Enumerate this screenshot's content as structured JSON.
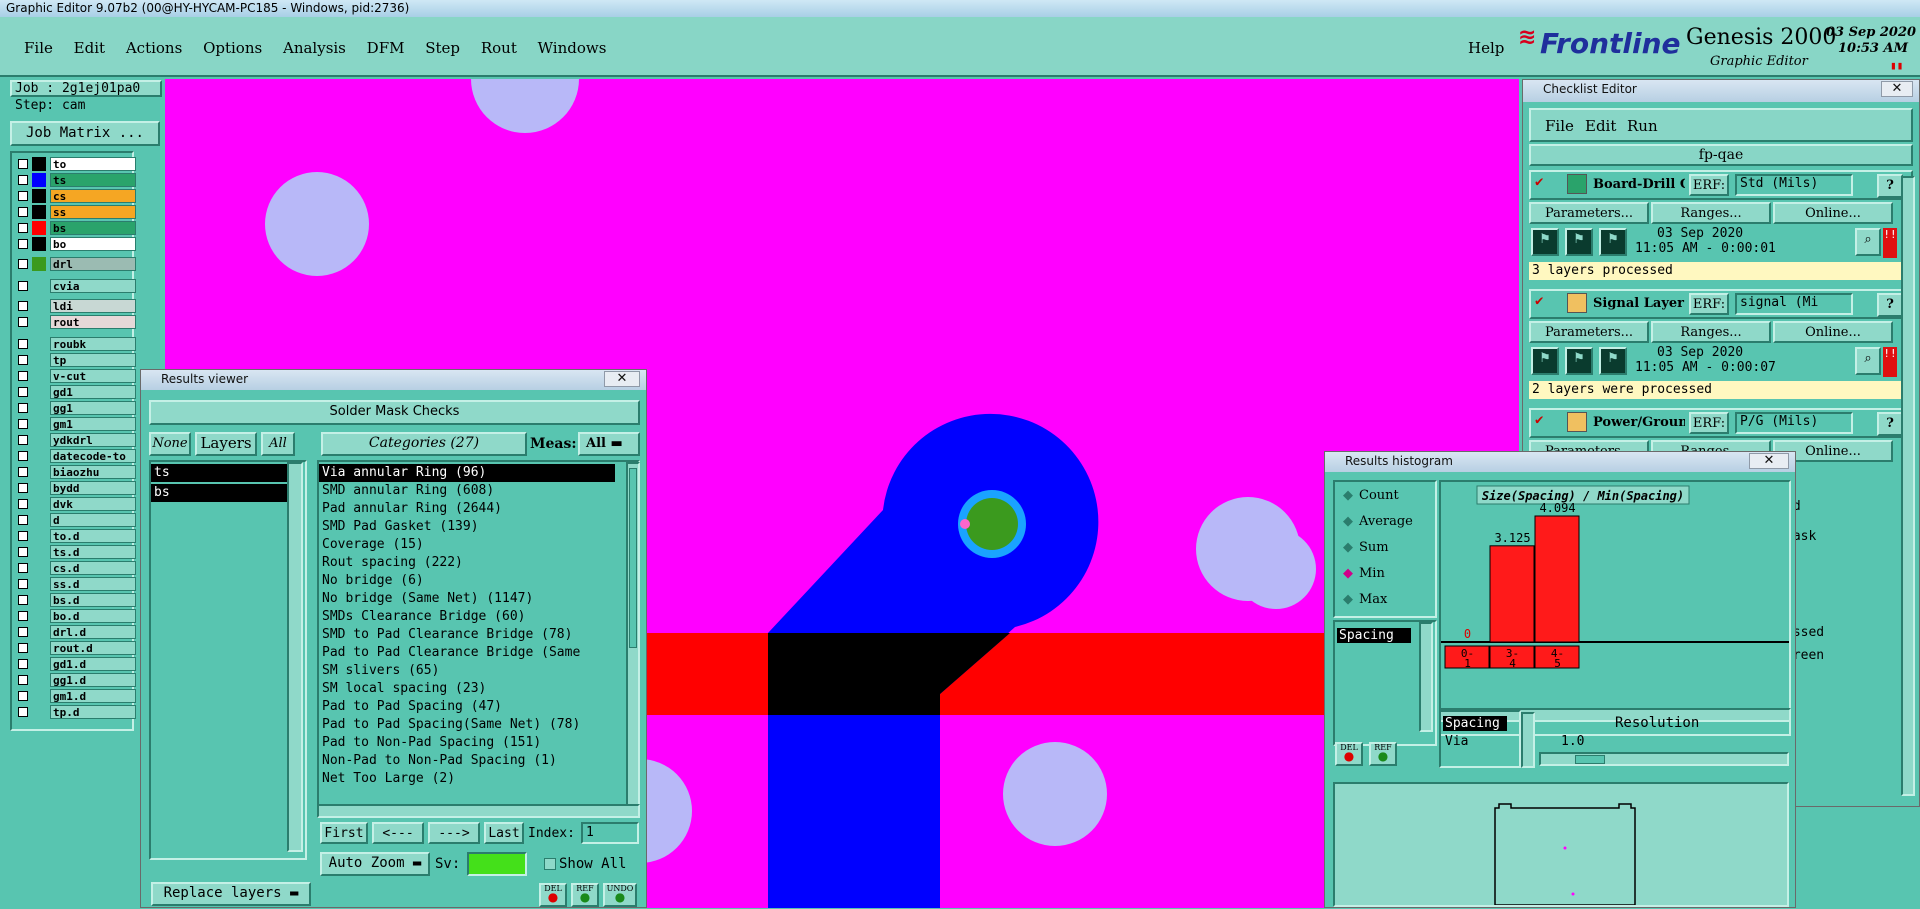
{
  "window": {
    "title": "Graphic Editor 9.07b2 (00@HY-HYCAM-PC185 - Windows, pid:2736)"
  },
  "menu": {
    "items": [
      "File",
      "Edit",
      "Actions",
      "Options",
      "Analysis",
      "DFM",
      "Step",
      "Rout",
      "Windows"
    ],
    "help": "Help"
  },
  "brand": {
    "logo": "Frontline",
    "product": "Genesis 2000",
    "subtitle": "Graphic Editor",
    "date": "03 Sep 2020",
    "time": "10:53 AM"
  },
  "job": {
    "job_label": "Job : 2g1ej01pa0",
    "step_label": "Step: cam",
    "matrix_button": "Job Matrix ..."
  },
  "layers": [
    {
      "name": "to",
      "color": "#000000",
      "bg": "#ffffff"
    },
    {
      "name": "ts",
      "color": "#0000ff",
      "bg": "#2aa36b"
    },
    {
      "name": "cs",
      "color": "#000000",
      "bg": "#f5a623"
    },
    {
      "name": "ss",
      "color": "#000000",
      "bg": "#f5a623"
    },
    {
      "name": "bs",
      "color": "#ff0000",
      "bg": "#2aa36b"
    },
    {
      "name": "bo",
      "color": "#000000",
      "bg": "#ffffff"
    },
    {
      "name": "drl",
      "color": "#3b9a1e",
      "bg": "#9bbbb2"
    },
    {
      "name": "cvia",
      "color": "#58c5b0",
      "bg": "#8fd9c9"
    },
    {
      "name": "ldi",
      "color": "#58c5b0",
      "bg": "#c8d8d4"
    },
    {
      "name": "rout",
      "color": "#58c5b0",
      "bg": "#e6d8d8"
    },
    {
      "name": "roubk",
      "color": "#58c5b0",
      "bg": "#8fd9c9"
    },
    {
      "name": "tp",
      "color": "#58c5b0",
      "bg": "#8fd9c9"
    },
    {
      "name": "v-cut",
      "color": "#58c5b0",
      "bg": "#8fd9c9"
    },
    {
      "name": "gd1",
      "color": "#58c5b0",
      "bg": "#8fd9c9"
    },
    {
      "name": "gg1",
      "color": "#58c5b0",
      "bg": "#8fd9c9"
    },
    {
      "name": "gm1",
      "color": "#58c5b0",
      "bg": "#8fd9c9"
    },
    {
      "name": "ydkdrl",
      "color": "#58c5b0",
      "bg": "#8fd9c9"
    },
    {
      "name": "datecode-to",
      "color": "#58c5b0",
      "bg": "#8fd9c9"
    },
    {
      "name": "biaozhu",
      "color": "#58c5b0",
      "bg": "#8fd9c9"
    },
    {
      "name": "bydd",
      "color": "#58c5b0",
      "bg": "#8fd9c9"
    },
    {
      "name": "dvk",
      "color": "#58c5b0",
      "bg": "#8fd9c9"
    },
    {
      "name": "d",
      "color": "#58c5b0",
      "bg": "#8fd9c9"
    },
    {
      "name": "to.d",
      "color": "#58c5b0",
      "bg": "#8fd9c9"
    },
    {
      "name": "ts.d",
      "color": "#58c5b0",
      "bg": "#8fd9c9"
    },
    {
      "name": "cs.d",
      "color": "#58c5b0",
      "bg": "#8fd9c9"
    },
    {
      "name": "ss.d",
      "color": "#58c5b0",
      "bg": "#8fd9c9"
    },
    {
      "name": "bs.d",
      "color": "#58c5b0",
      "bg": "#8fd9c9"
    },
    {
      "name": "bo.d",
      "color": "#58c5b0",
      "bg": "#8fd9c9"
    },
    {
      "name": "drl.d",
      "color": "#58c5b0",
      "bg": "#8fd9c9"
    },
    {
      "name": "rout.d",
      "color": "#58c5b0",
      "bg": "#8fd9c9"
    },
    {
      "name": "gd1.d",
      "color": "#58c5b0",
      "bg": "#8fd9c9"
    },
    {
      "name": "gg1.d",
      "color": "#58c5b0",
      "bg": "#8fd9c9"
    },
    {
      "name": "gm1.d",
      "color": "#58c5b0",
      "bg": "#8fd9c9"
    },
    {
      "name": "tp.d",
      "color": "#58c5b0",
      "bg": "#8fd9c9"
    }
  ],
  "results_viewer": {
    "title": "Results viewer",
    "header": "Solder Mask Checks",
    "none_btn": "None",
    "layers_btn": "Layers",
    "all_btn": "All",
    "categories_label": "Categories (27)",
    "meas_label": "Meas:",
    "meas_value": "All",
    "layers": [
      "ts",
      "bs"
    ],
    "categories": [
      "Via annular Ring (96)",
      "SMD annular Ring (608)",
      "Pad annular Ring (2644)",
      "SMD Pad Gasket (139)",
      "Coverage (15)",
      "Rout spacing (222)",
      "No bridge (6)",
      "No bridge (Same Net) (1147)",
      "SMDs Clearance Bridge (60)",
      "SMD to Pad Clearance Bridge (78)",
      "Pad to Pad Clearance Bridge (Same",
      "SM slivers (65)",
      "SM local spacing (23)",
      "Pad to Pad Spacing (47)",
      "Pad to Pad Spacing(Same Net) (78)",
      "Pad to Non-Pad Spacing (151)",
      "Non-Pad to Non-Pad Spacing (1)",
      "Net Too Large (2)"
    ],
    "nav": {
      "first": "First",
      "prev": "<---",
      "next": "--->",
      "last": "Last",
      "index_label": "Index:",
      "index_value": "1"
    },
    "replace_layers": "Replace layers",
    "auto_zoom": "Auto Zoom",
    "sv_label": "Sv:",
    "show_all": "Show All",
    "foot": {
      "del": "DEL",
      "ref": "REF",
      "undo": "UNDO"
    }
  },
  "checklist": {
    "title": "Checklist Editor",
    "menu": [
      "File",
      "Edit",
      "Run"
    ],
    "name": "fp-qae",
    "erf_label": "ERF:",
    "params": "Parameters...",
    "ranges": "Ranges...",
    "online": "Online...",
    "checks": [
      {
        "name": "Board-Drill Che",
        "erf": "Std (Mils)",
        "date": "03 Sep 2020",
        "time": "11:05 AM - 0:00:01",
        "status": "3 layers processed"
      },
      {
        "name": "Signal Layer Ch",
        "erf": "signal (Mi",
        "date": "03 Sep 2020",
        "time": "11:05 AM - 0:00:07",
        "status": "2 layers were processed"
      },
      {
        "name": "Power/Ground C",
        "erf": "P/G (Mils)",
        "date": "",
        "time": "",
        "status": ""
      }
    ],
    "partial": {
      "r1": "ed",
      "r2": "mask",
      "r3": "essed",
      "r4": "creen"
    }
  },
  "histogram": {
    "title": "Results histogram",
    "modes": [
      "Count",
      "Average",
      "Sum",
      "Min",
      "Max"
    ],
    "selected_mode": "Min",
    "measure": "Spacing",
    "chart_title": "Size(Spacing) / Min(Spacing)",
    "resolution_label": "Resolution",
    "resolution_value": "1.0",
    "legend": [
      "Spacing",
      "Via"
    ],
    "foot": {
      "del": "DEL",
      "ref": "REF"
    }
  },
  "chart_data": {
    "type": "bar",
    "title": "Size(Spacing) / Min(Spacing)",
    "categories": [
      "0-1",
      "3-4",
      "4-5"
    ],
    "values": [
      0,
      3.125,
      4.094
    ],
    "labels": [
      "0",
      "3.125",
      "4.094"
    ]
  },
  "colors": {
    "panel": "#58c5b0",
    "menu": "#88d6c6",
    "mask": "#ff00ff",
    "top": "#0000ff",
    "bottom": "#ff0000",
    "bar": "#ff1a1a"
  }
}
